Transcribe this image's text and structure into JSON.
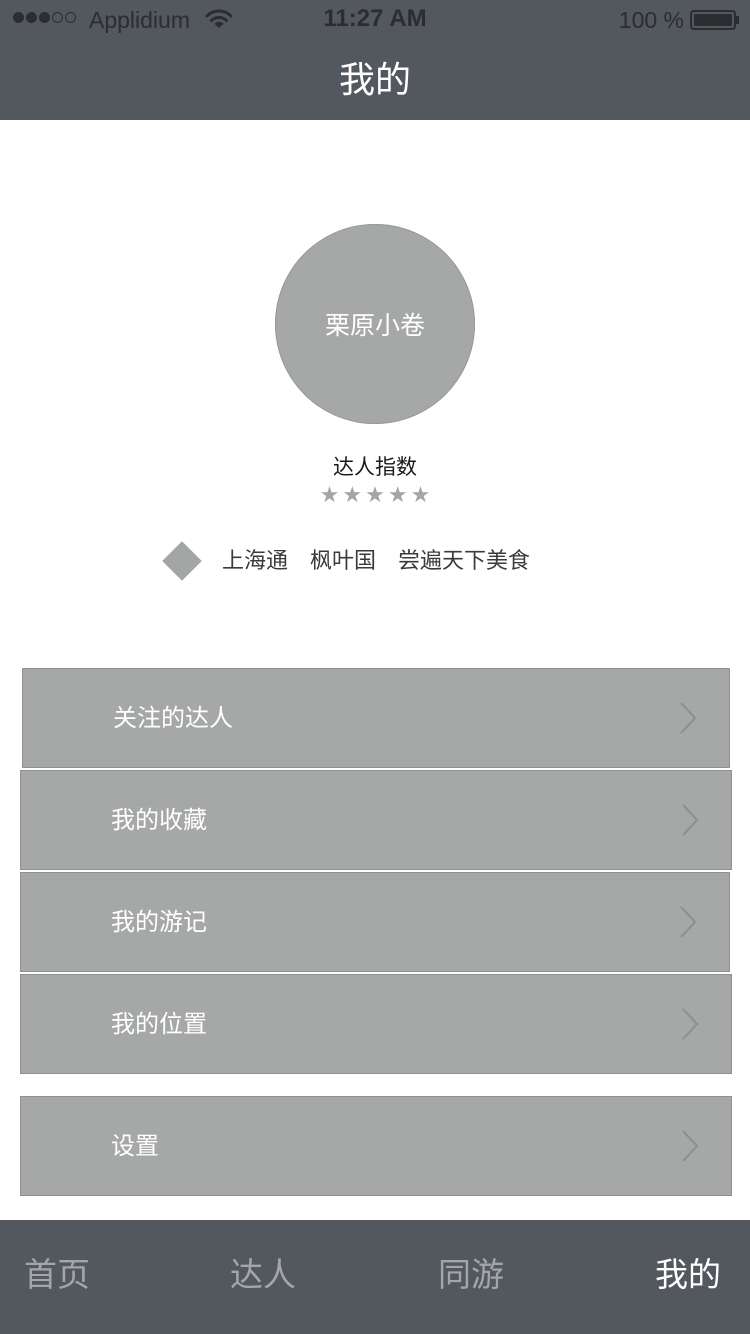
{
  "status_bar": {
    "carrier": "Applidium",
    "time": "11:27 AM",
    "battery": "100 %"
  },
  "nav": {
    "title": "我的"
  },
  "profile": {
    "avatar_name": "栗原小卷",
    "expert_label": "达人指数",
    "star_rating": 5,
    "stars": [
      "★",
      "★",
      "★",
      "★",
      "★"
    ],
    "tags": [
      "上海通",
      "枫叶国",
      "尝遍天下美食"
    ]
  },
  "menu": {
    "items": [
      {
        "label": "关注的达人"
      },
      {
        "label": "我的收藏"
      },
      {
        "label": "我的游记"
      },
      {
        "label": "我的位置"
      }
    ],
    "settings_label": "设置"
  },
  "tab_bar": {
    "tabs": [
      {
        "label": "首页"
      },
      {
        "label": "达人"
      },
      {
        "label": "同游"
      },
      {
        "label": "我的"
      }
    ],
    "active_index": 3
  },
  "colors": {
    "header_bg": "#53575e",
    "placeholder_gray": "#a5a8a7",
    "tab_inactive": "#a3a6a8",
    "tab_active": "#ffffff"
  }
}
